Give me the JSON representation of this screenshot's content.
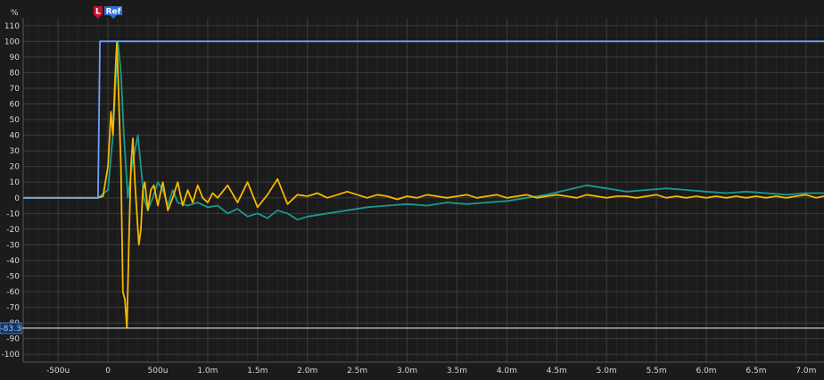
{
  "chart_data": {
    "type": "line",
    "title": "",
    "xlabel": "",
    "ylabel": "%",
    "xlim": [
      -0.00085,
      0.00718
    ],
    "ylim": [
      -105,
      115
    ],
    "grid": true,
    "x_ticks": [
      -0.0005,
      0,
      0.0005,
      0.001,
      0.0015,
      0.002,
      0.0025,
      0.003,
      0.0035,
      0.004,
      0.0045,
      0.005,
      0.0055,
      0.006,
      0.0065,
      0.007
    ],
    "x_tick_labels": [
      "-500u",
      "0",
      "500u",
      "1.0m",
      "1.5m",
      "2.0m",
      "2.5m",
      "3.0m",
      "3.5m",
      "4.0m",
      "4.5m",
      "5.0m",
      "5.5m",
      "6.0m",
      "6.5m",
      "7.0m"
    ],
    "y_ticks": [
      110,
      100,
      90,
      80,
      70,
      60,
      50,
      40,
      30,
      20,
      10,
      0,
      -10,
      -20,
      -30,
      -40,
      -50,
      -60,
      -70,
      -80,
      -90,
      -100
    ],
    "y_tick_labels": [
      "110",
      "100",
      "90",
      "80",
      "70",
      "60",
      "50",
      "40",
      "30",
      "20",
      "10",
      "0",
      "-10",
      "-20",
      "-30",
      "-40",
      "-50",
      "-60",
      "-70",
      "-80",
      "-90",
      "-100"
    ],
    "markers": [
      {
        "label": "L",
        "x": -0.0001,
        "color": "#c8102e"
      },
      {
        "label": "Ref",
        "x": 0.0,
        "color": "#2a6fd6"
      }
    ],
    "cursor": {
      "value": -83.3,
      "label": "-83.3"
    },
    "series": [
      {
        "color": "#6aa0ff",
        "x": [
          -0.00085,
          -0.0001,
          -8e-05,
          0.0,
          0.00718
        ],
        "y": [
          0,
          0,
          100,
          100,
          100
        ]
      },
      {
        "color": "#f5b800",
        "x": [
          -0.00085,
          -0.0001,
          -5e-05,
          0.0,
          3e-05,
          5e-05,
          7e-05,
          9e-05,
          0.00011,
          0.00013,
          0.00015,
          0.00017,
          0.00019,
          0.00021,
          0.00023,
          0.00025,
          0.00027,
          0.00029,
          0.00031,
          0.00033,
          0.00035,
          0.00037,
          0.0004,
          0.00043,
          0.00046,
          0.0005,
          0.00055,
          0.0006,
          0.00065,
          0.0007,
          0.00075,
          0.0008,
          0.00085,
          0.0009,
          0.00095,
          0.001,
          0.00105,
          0.0011,
          0.0012,
          0.0013,
          0.0014,
          0.0015,
          0.0016,
          0.0017,
          0.0018,
          0.0019,
          0.002,
          0.0021,
          0.0022,
          0.0023,
          0.0024,
          0.0025,
          0.0026,
          0.0027,
          0.0028,
          0.0029,
          0.003,
          0.0031,
          0.0032,
          0.0033,
          0.0034,
          0.0035,
          0.0036,
          0.0037,
          0.0038,
          0.0039,
          0.004,
          0.0041,
          0.0042,
          0.0043,
          0.0044,
          0.0045,
          0.0046,
          0.0047,
          0.0048,
          0.0049,
          0.005,
          0.0051,
          0.0052,
          0.0053,
          0.0054,
          0.0055,
          0.0056,
          0.0057,
          0.0058,
          0.0059,
          0.006,
          0.0061,
          0.0062,
          0.0063,
          0.0064,
          0.0065,
          0.0066,
          0.0067,
          0.0068,
          0.0069,
          0.007,
          0.0071,
          0.00718
        ],
        "y": [
          0,
          0,
          1,
          20,
          55,
          40,
          75,
          100,
          60,
          20,
          -60,
          -65,
          -83,
          -30,
          20,
          38,
          10,
          -10,
          -30,
          -20,
          5,
          10,
          -8,
          5,
          8,
          -5,
          10,
          -8,
          0,
          10,
          -5,
          5,
          -3,
          8,
          0,
          -3,
          3,
          0,
          8,
          -3,
          10,
          -6,
          2,
          12,
          -4,
          2,
          1,
          3,
          0,
          2,
          4,
          2,
          0,
          2,
          1,
          -1,
          1,
          0,
          2,
          1,
          0,
          1,
          2,
          0,
          1,
          2,
          0,
          1,
          2,
          0,
          1,
          2,
          1,
          0,
          2,
          1,
          0,
          1,
          1,
          0,
          1,
          2,
          0,
          1,
          0,
          1,
          0,
          1,
          0,
          1,
          0,
          1,
          0,
          1,
          0,
          1,
          2,
          0,
          1
        ]
      },
      {
        "color": "#1a9a8c",
        "x": [
          -0.00085,
          -0.0001,
          0.0,
          5e-05,
          0.0001,
          0.00013,
          0.00016,
          0.0002,
          0.00024,
          0.00027,
          0.0003,
          0.00033,
          0.00036,
          0.0004,
          0.00045,
          0.0005,
          0.00055,
          0.0006,
          0.00065,
          0.0007,
          0.0008,
          0.0009,
          0.001,
          0.0011,
          0.0012,
          0.0013,
          0.0014,
          0.0015,
          0.0016,
          0.0017,
          0.0018,
          0.0019,
          0.002,
          0.0022,
          0.0024,
          0.0026,
          0.0028,
          0.003,
          0.0032,
          0.0034,
          0.0036,
          0.0038,
          0.004,
          0.0042,
          0.0044,
          0.0046,
          0.0048,
          0.005,
          0.0052,
          0.0054,
          0.0056,
          0.0058,
          0.006,
          0.0062,
          0.0064,
          0.0066,
          0.0068,
          0.007,
          0.00718
        ],
        "y": [
          0,
          0,
          5,
          40,
          100,
          80,
          40,
          0,
          20,
          30,
          40,
          20,
          0,
          -8,
          0,
          10,
          5,
          -5,
          5,
          -3,
          -5,
          -3,
          -6,
          -5,
          -10,
          -7,
          -12,
          -10,
          -13,
          -8,
          -10,
          -14,
          -12,
          -10,
          -8,
          -6,
          -5,
          -4,
          -5,
          -3,
          -4,
          -3,
          -2,
          0,
          2,
          5,
          8,
          6,
          4,
          5,
          6,
          5,
          4,
          3,
          4,
          3,
          2,
          3,
          3
        ]
      }
    ]
  }
}
